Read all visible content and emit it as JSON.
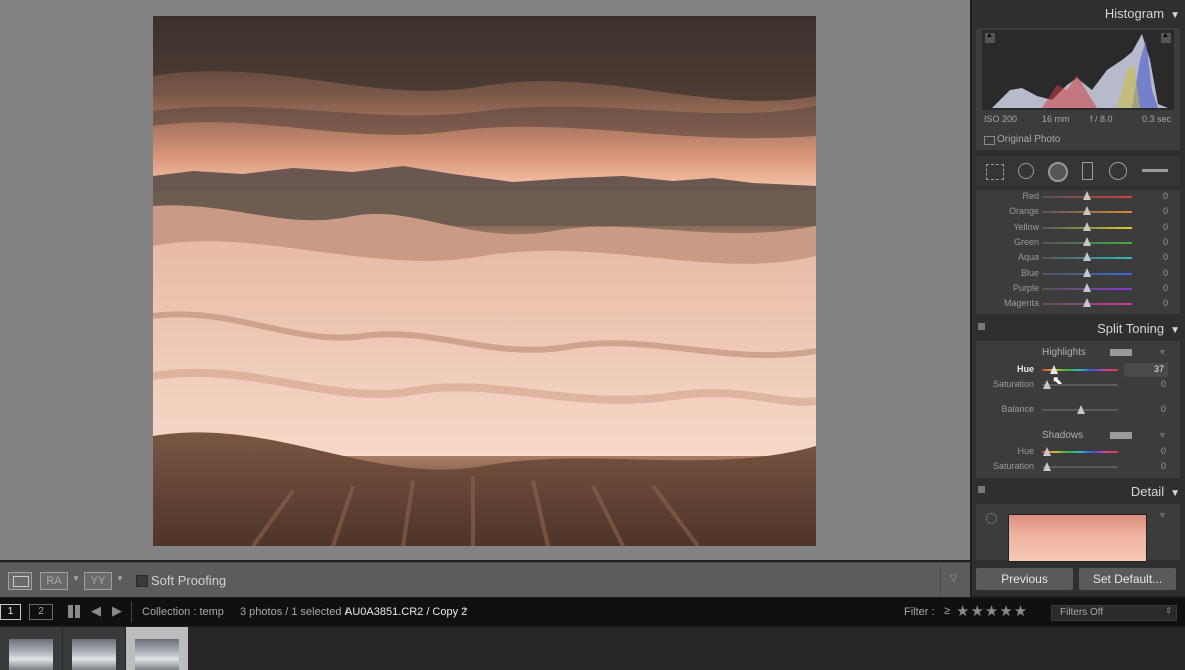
{
  "histogram": {
    "title": "Histogram",
    "iso": "ISO 200",
    "focal": "16 mm",
    "aperture": "f / 8.0",
    "shutter": "0.3 sec",
    "original_photo_label": "Original Photo"
  },
  "hsl": {
    "rows": [
      {
        "label": "Red",
        "value": "0",
        "color": "#d04040"
      },
      {
        "label": "Orange",
        "value": "0",
        "color": "#e08a30"
      },
      {
        "label": "Yellow",
        "value": "0",
        "color": "#d8cc30"
      },
      {
        "label": "Green",
        "value": "0",
        "color": "#40b040"
      },
      {
        "label": "Aqua",
        "value": "0",
        "color": "#30b8b8"
      },
      {
        "label": "Blue",
        "value": "0",
        "color": "#3a6ad8"
      },
      {
        "label": "Purple",
        "value": "0",
        "color": "#8a3ad0"
      },
      {
        "label": "Magenta",
        "value": "0",
        "color": "#d03aa0"
      }
    ]
  },
  "split_toning": {
    "title": "Split Toning",
    "highlights_label": "Highlights",
    "hue_label": "Hue",
    "hue_value": "37",
    "saturation_label": "Saturation",
    "saturation_value": "0",
    "balance_label": "Balance",
    "balance_value": "0",
    "shadows_label": "Shadows",
    "shadows_hue_label": "Hue",
    "shadows_hue_value": "0",
    "shadows_saturation_label": "Saturation",
    "shadows_saturation_value": "0"
  },
  "detail": {
    "title": "Detail"
  },
  "toolbar": {
    "soft_proofing": "Soft Proofing",
    "ra_label": "RA",
    "yy_label": "YY"
  },
  "buttons": {
    "previous": "Previous",
    "set_default": "Set Default..."
  },
  "filmstrip": {
    "page1": "1",
    "page2": "2",
    "collection": "Collection : temp",
    "photos_info": "3 photos / 1 selected /",
    "filename": "AU0A3851.CR2 / Copy 2",
    "filter_label": "Filter :",
    "filter_op": "≥",
    "filters_off": "Filters Off"
  },
  "icons": {
    "grid": "grid-icon",
    "prev": "arrow-left-icon",
    "next": "arrow-right-icon"
  }
}
